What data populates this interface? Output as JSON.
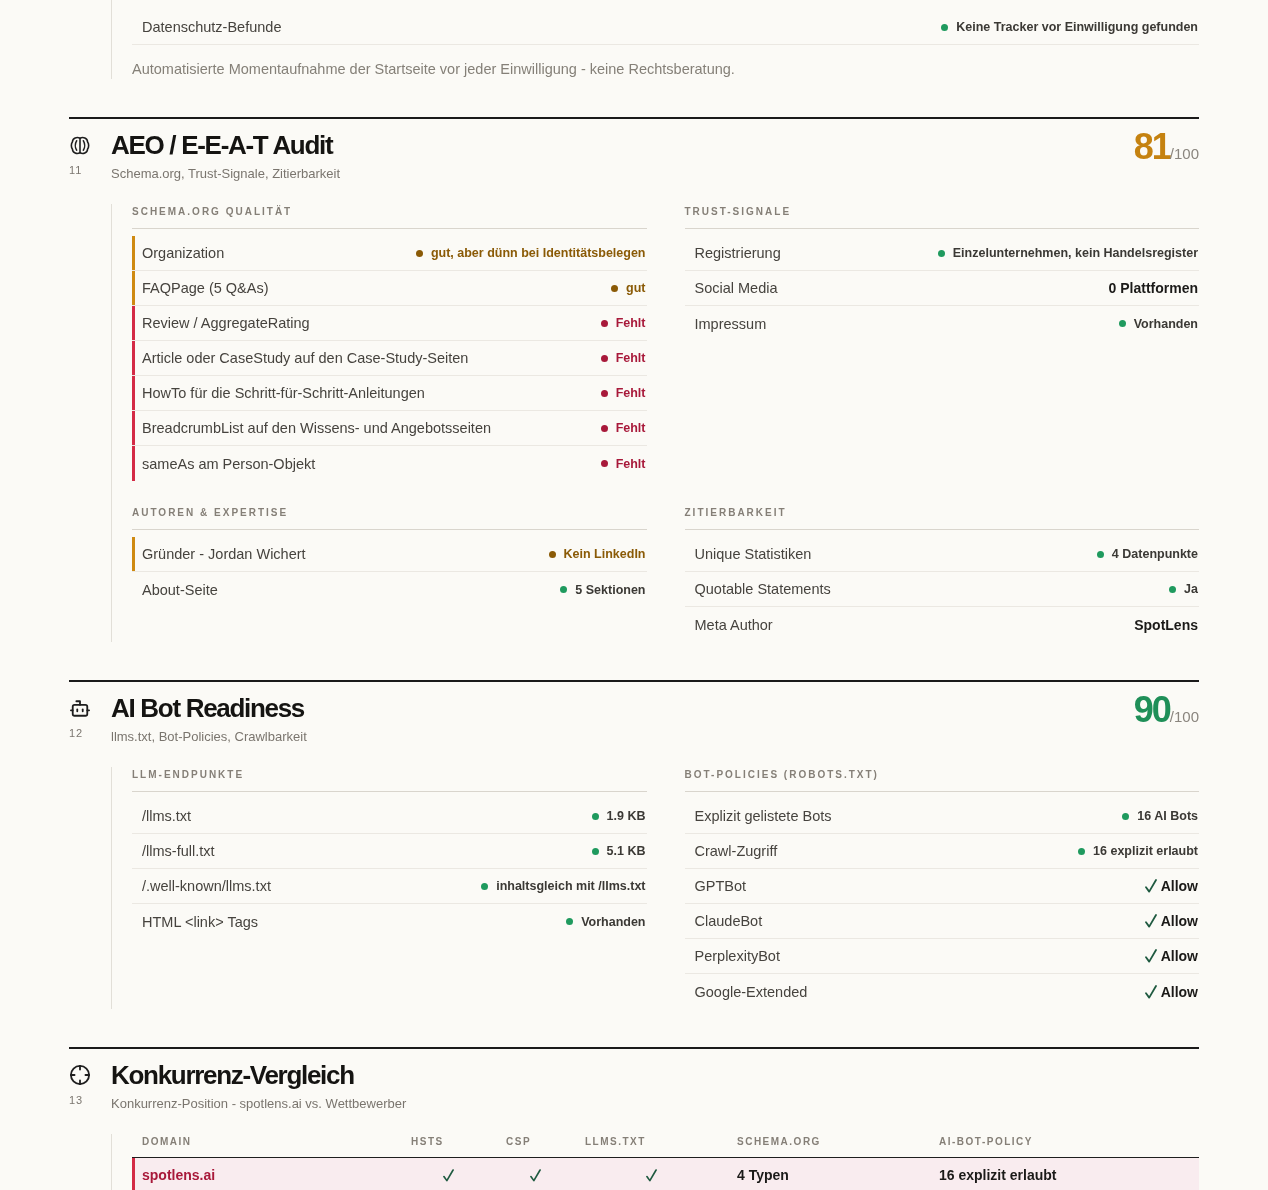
{
  "previous_section": {
    "rows": [
      {
        "label": "Datenschutz-Befunde",
        "kind": "ok",
        "value": "Keine Tracker vor Einwilligung gefunden"
      }
    ],
    "note": "Automatisierte Momentaufnahme der Startseite vor jeder Einwilligung - keine Rechtsberatung."
  },
  "sections": [
    {
      "kind": "panels",
      "number": "11",
      "title": "AEO / E-E-A-T Audit",
      "subtitle": "Schema.org, Trust-Signale, Zitierbarkeit",
      "score": {
        "value": "81",
        "max": "/100",
        "color": "#c58210"
      },
      "groups": [
        {
          "heading": "SCHEMA.ORG QUALITÄT",
          "rows": [
            {
              "label": "Organization",
              "kind": "warn",
              "value": "gut, aber dünn bei Identitätsbelegen"
            },
            {
              "label": "FAQPage (5 Q&As)",
              "kind": "warn",
              "value": "gut"
            },
            {
              "label": "Review / AggregateRating",
              "kind": "fail",
              "value": "Fehlt"
            },
            {
              "label": "Article oder CaseStudy auf den Case-Study-Seiten",
              "kind": "fail",
              "value": "Fehlt"
            },
            {
              "label": "HowTo für die Schritt-für-Schritt-Anleitungen",
              "kind": "fail",
              "value": "Fehlt"
            },
            {
              "label": "BreadcrumbList auf den Wissens- und Angebotsseiten",
              "kind": "fail",
              "value": "Fehlt"
            },
            {
              "label": "sameAs am Person-Objekt",
              "kind": "fail",
              "value": "Fehlt"
            }
          ]
        },
        {
          "heading": "TRUST-SIGNALE",
          "rows": [
            {
              "label": "Registrierung",
              "kind": "ok",
              "value": "Einzelunternehmen, kein Handelsregister"
            },
            {
              "label": "Social Media",
              "kind": "plain",
              "value": "0 Plattformen"
            },
            {
              "label": "Impressum",
              "kind": "ok",
              "value": "Vorhanden"
            }
          ]
        },
        {
          "heading": "AUTOREN & EXPERTISE",
          "rows": [
            {
              "label": "Gründer - Jordan Wichert",
              "kind": "warn",
              "value": "Kein LinkedIn"
            },
            {
              "label": "About-Seite",
              "kind": "ok",
              "value": "5 Sektionen"
            }
          ]
        },
        {
          "heading": "ZITIERBARKEIT",
          "rows": [
            {
              "label": "Unique Statistiken",
              "kind": "ok",
              "value": "4 Datenpunkte"
            },
            {
              "label": "Quotable Statements",
              "kind": "ok",
              "value": "Ja"
            },
            {
              "label": "Meta Author",
              "kind": "plain",
              "value": "SpotLens"
            }
          ]
        }
      ]
    },
    {
      "kind": "panels",
      "number": "12",
      "title": "AI Bot Readiness",
      "subtitle": "llms.txt, Bot-Policies, Crawlbarkeit",
      "score": {
        "value": "90",
        "max": "/100",
        "color": "#1f8f58"
      },
      "groups": [
        {
          "heading": "LLM-ENDPUNKTE",
          "rows": [
            {
              "label": "/llms.txt",
              "kind": "ok",
              "value": "1.9 KB"
            },
            {
              "label": "/llms-full.txt",
              "kind": "ok",
              "value": "5.1 KB"
            },
            {
              "label": "/.well-known/llms.txt",
              "kind": "ok",
              "value": "inhaltsgleich mit /llms.txt"
            },
            {
              "label": "HTML <link> Tags",
              "kind": "ok",
              "value": "Vorhanden"
            }
          ]
        },
        {
          "heading": "BOT-POLICIES (ROBOTS.TXT)",
          "rows": [
            {
              "label": "Explizit gelistete Bots",
              "kind": "ok",
              "value": "16 AI Bots"
            },
            {
              "label": "Crawl-Zugriff",
              "kind": "ok",
              "value": "16 explizit erlaubt"
            },
            {
              "label": "GPTBot",
              "kind": "check",
              "value": "Allow"
            },
            {
              "label": "ClaudeBot",
              "kind": "check",
              "value": "Allow"
            },
            {
              "label": "PerplexityBot",
              "kind": "check",
              "value": "Allow"
            },
            {
              "label": "Google-Extended",
              "kind": "check",
              "value": "Allow"
            }
          ]
        }
      ]
    },
    {
      "kind": "table",
      "number": "13",
      "title": "Konkurrenz-Vergleich",
      "subtitle": "Konkurrenz-Position - spotlens.ai vs. Wettbewerber",
      "table": {
        "columns": [
          "DOMAIN",
          "HSTS",
          "CSP",
          "LLMS.TXT",
          "SCHEMA.ORG",
          "AI-BOT-POLICY"
        ],
        "rows": [
          {
            "highlighted": true,
            "cells": [
              {
                "kind": "text",
                "text": "spotlens.ai"
              },
              {
                "kind": "check",
                "checked": true
              },
              {
                "kind": "check",
                "checked": true
              },
              {
                "kind": "check",
                "checked": true
              },
              {
                "kind": "text",
                "text": "4 Typen"
              },
              {
                "kind": "text",
                "text": "16 explizit erlaubt"
              }
            ]
          }
        ]
      }
    }
  ]
}
